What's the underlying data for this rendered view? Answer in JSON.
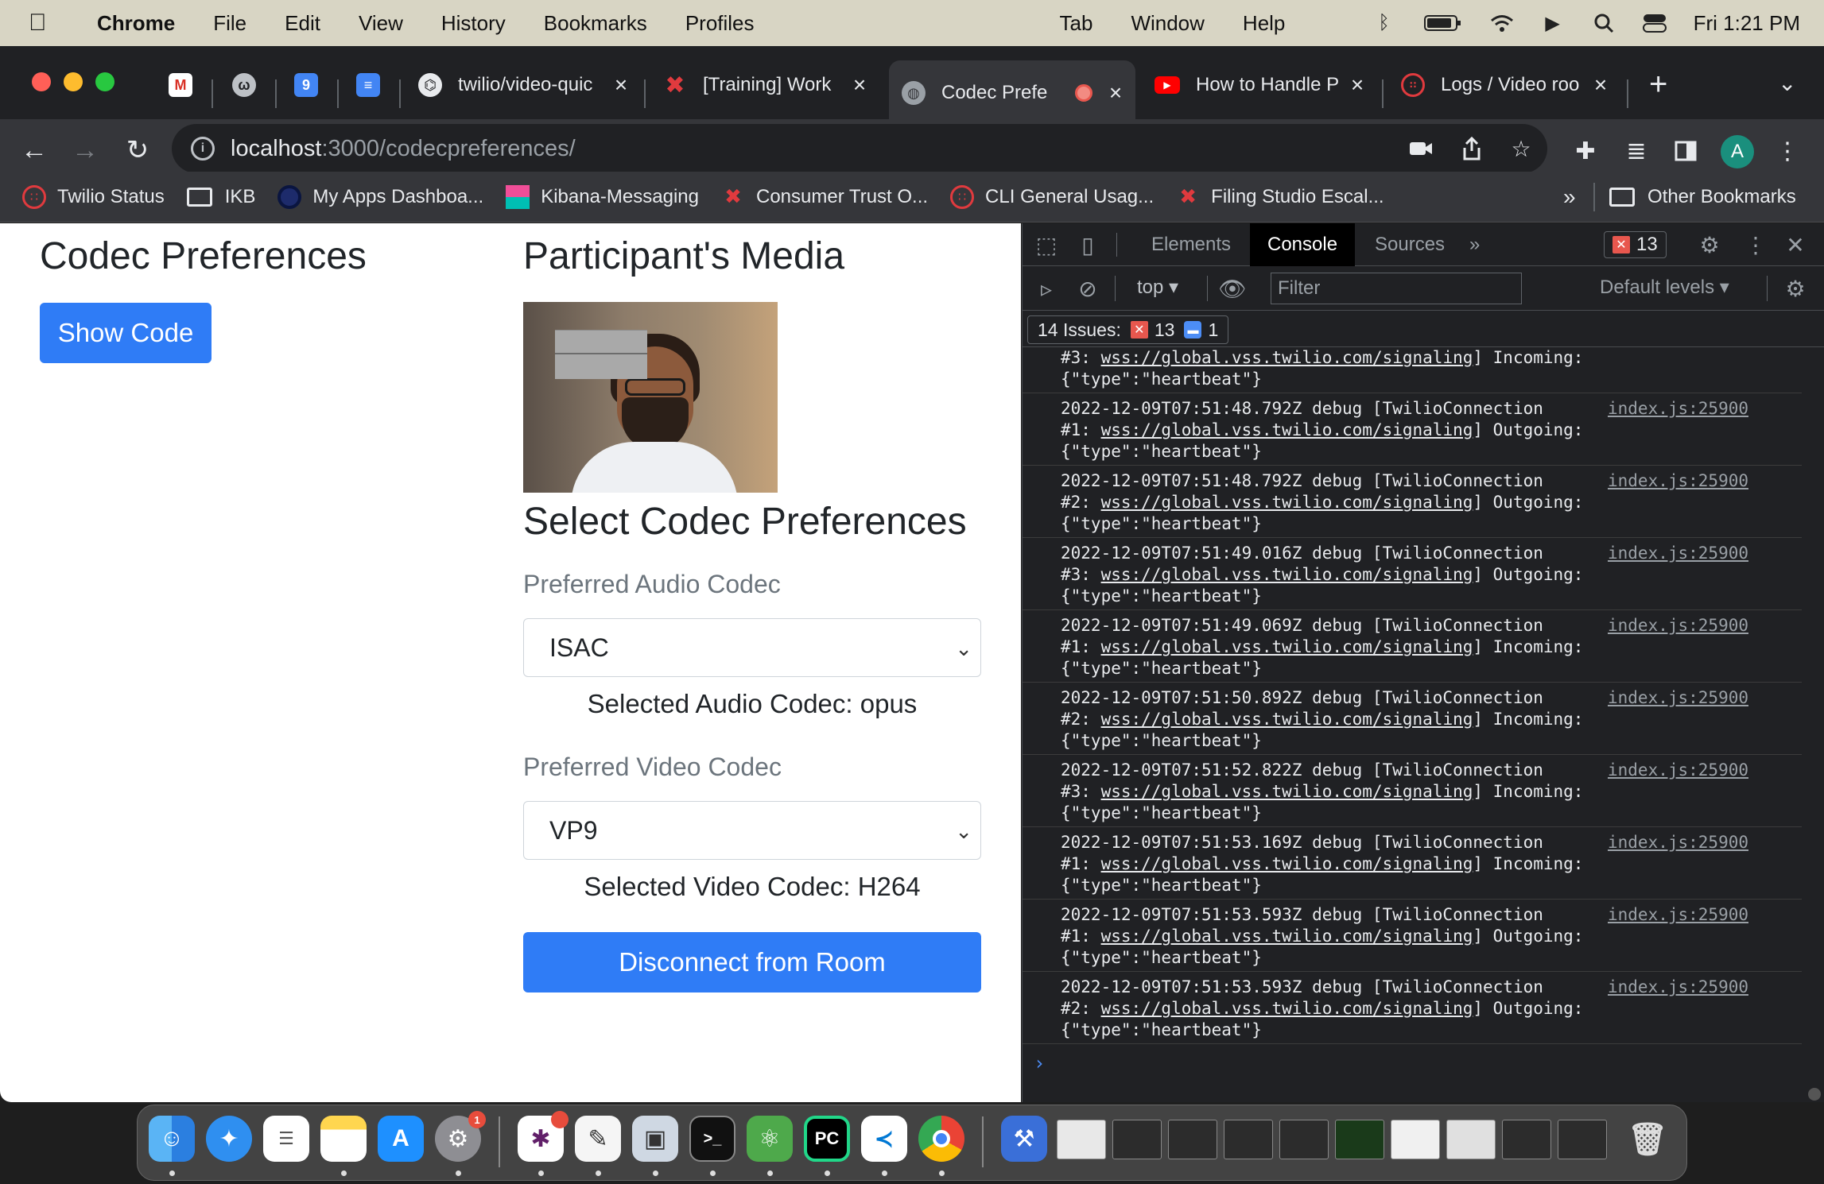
{
  "menubar": {
    "app": "Chrome",
    "items": [
      "File",
      "Edit",
      "View",
      "History",
      "Bookmarks",
      "Profiles",
      "Tab",
      "Window",
      "Help"
    ],
    "clock": "Fri  1:21 PM"
  },
  "tabs": [
    {
      "title": "twilio/video-quic",
      "icon": "github-icon"
    },
    {
      "title": "[Training] Work",
      "icon": "twilio-icon"
    },
    {
      "title": "Codec Prefe",
      "icon": "globe-icon",
      "active": true
    },
    {
      "title": "How to Handle P",
      "icon": "youtube-icon"
    },
    {
      "title": "Logs / Video roo",
      "icon": "twilio-icon"
    }
  ],
  "address": {
    "host": "localhost",
    "rest": ":3000/codecpreferences/"
  },
  "avatar_letter": "A",
  "bookmarks": [
    {
      "label": "Twilio Status"
    },
    {
      "label": "IKB"
    },
    {
      "label": "My Apps Dashboa..."
    },
    {
      "label": "Kibana-Messaging"
    },
    {
      "label": "Consumer Trust O..."
    },
    {
      "label": "CLI General Usag..."
    },
    {
      "label": "Filing Studio Escal..."
    }
  ],
  "bookmarks_more": "»",
  "other_bookmarks": "Other Bookmarks",
  "page": {
    "title": "Codec Preferences",
    "show_code": "Show Code",
    "media_heading": "Participant's Media",
    "select_heading": "Select Codec Preferences",
    "audio_label": "Preferred Audio Codec",
    "audio_value": "ISAC",
    "audio_selected": "Selected Audio Codec: opus",
    "video_label": "Preferred Video Codec",
    "video_value": "VP9",
    "video_selected": "Selected Video Codec: H264",
    "disconnect": "Disconnect from Room"
  },
  "devtools": {
    "tabs": [
      "Elements",
      "Console",
      "Sources"
    ],
    "more": "»",
    "error_count": "13",
    "context": "top",
    "filter_placeholder": "Filter",
    "levels": "Default levels",
    "issues_label": "14 Issues:",
    "issues_errors": "13",
    "issues_info": "1",
    "first_partial": {
      "line2_prefix": "#3: ",
      "link": "wss://global.vss.twilio.com/signaling",
      "line2_suffix": "] Incoming:",
      "line3": "{\"type\":\"heartbeat\"}"
    },
    "logs": [
      {
        "ts": "2022-12-09T07:51:48.792Z debug [TwilioConnection",
        "conn": "#1: ",
        "dir": "] Outgoing:"
      },
      {
        "ts": "2022-12-09T07:51:48.792Z debug [TwilioConnection",
        "conn": "#2: ",
        "dir": "] Outgoing:"
      },
      {
        "ts": "2022-12-09T07:51:49.016Z debug [TwilioConnection",
        "conn": "#3: ",
        "dir": "] Outgoing:"
      },
      {
        "ts": "2022-12-09T07:51:49.069Z debug [TwilioConnection",
        "conn": "#1: ",
        "dir": "] Incoming:"
      },
      {
        "ts": "2022-12-09T07:51:50.892Z debug [TwilioConnection",
        "conn": "#2: ",
        "dir": "] Incoming:"
      },
      {
        "ts": "2022-12-09T07:51:52.822Z debug [TwilioConnection",
        "conn": "#3: ",
        "dir": "] Incoming:"
      },
      {
        "ts": "2022-12-09T07:51:53.169Z debug [TwilioConnection",
        "conn": "#1: ",
        "dir": "] Incoming:"
      },
      {
        "ts": "2022-12-09T07:51:53.593Z debug [TwilioConnection",
        "conn": "#1: ",
        "dir": "] Outgoing:"
      },
      {
        "ts": "2022-12-09T07:51:53.593Z debug [TwilioConnection",
        "conn": "#2: ",
        "dir": "] Outgoing:"
      }
    ],
    "log_link": "wss://global.vss.twilio.com/signaling",
    "log_payload": "{\"type\":\"heartbeat\"}",
    "log_source": "index.js:25900",
    "prompt": "›"
  },
  "dock": {
    "badge_settings": "1",
    "badge_slack": "",
    "pycharm_label": "PC",
    "terminal_label": ">_"
  },
  "colors": {
    "accent": "#2f7cf6",
    "devtools_bg": "#202124",
    "error": "#e8574e"
  }
}
